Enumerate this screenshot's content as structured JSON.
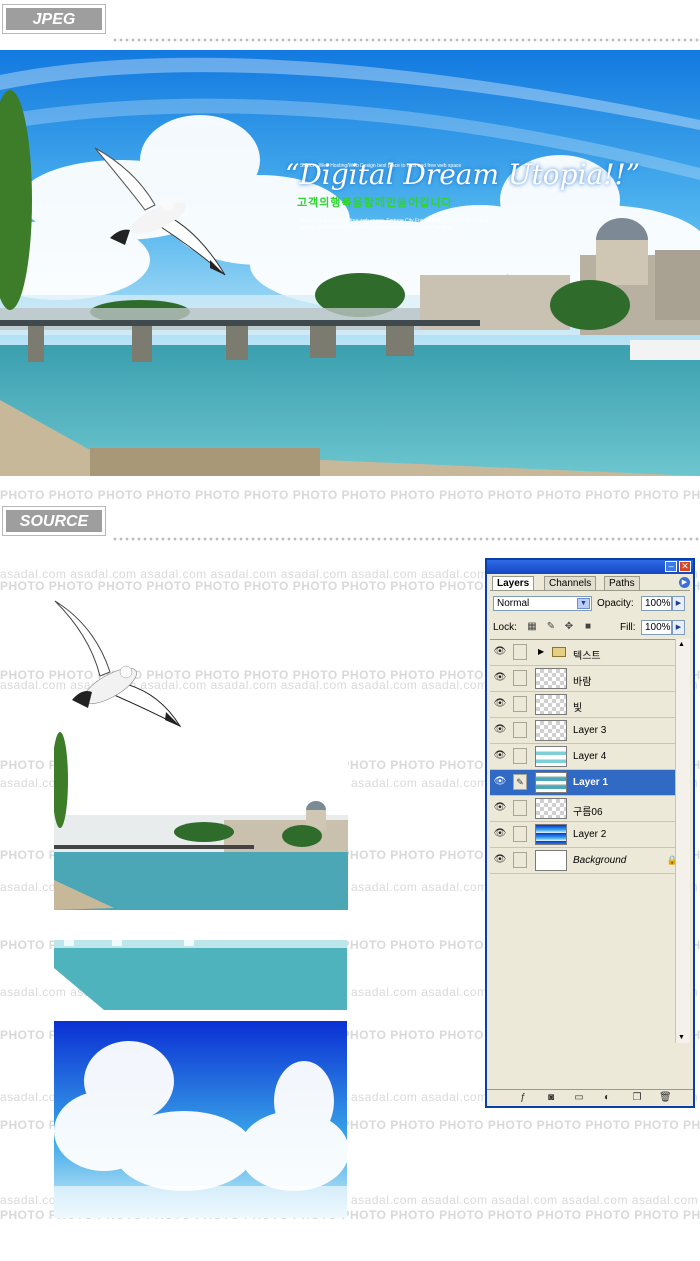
{
  "sections": {
    "jpeg_label": "JPEG",
    "source_label": "SOURCE"
  },
  "watermark": {
    "photo": "PHOTO",
    "site": "asadal.com"
  },
  "hero": {
    "title": "“Digital Dream Utopia!!”",
    "subtitle": "고객의행복을함께만들어갑니다",
    "small_lines": [
      "Select --Web Hosting/Web Design  best place to host and free web space",
      "name registration and free web space. Fortune City Forwarding/Domain/Web hosting",
      "Select --Web Hosting/Web Design  best place to host your is the best"
    ]
  },
  "photoshop": {
    "tabs": [
      "Layers",
      "Channels",
      "Paths"
    ],
    "active_tab": "Layers",
    "blend_mode": "Normal",
    "opacity_label": "Opacity:",
    "opacity_value": "100%",
    "lock_label": "Lock:",
    "fill_label": "Fill:",
    "fill_value": "100%",
    "layers": [
      {
        "name": "텍스트",
        "type": "group"
      },
      {
        "name": "바람",
        "type": "layer"
      },
      {
        "name": "빛",
        "type": "layer"
      },
      {
        "name": "Layer 3",
        "type": "layer"
      },
      {
        "name": "Layer 4",
        "type": "layer"
      },
      {
        "name": "Layer 1",
        "type": "layer",
        "selected": true
      },
      {
        "name": "구름06",
        "type": "layer"
      },
      {
        "name": "Layer 2",
        "type": "layer"
      },
      {
        "name": "Background",
        "type": "background"
      }
    ]
  },
  "colors": {
    "sky": "#1e8fe6",
    "water": "#4fb3bd",
    "panel_border": "#0a3fa8",
    "selected_layer": "#316ac5"
  }
}
